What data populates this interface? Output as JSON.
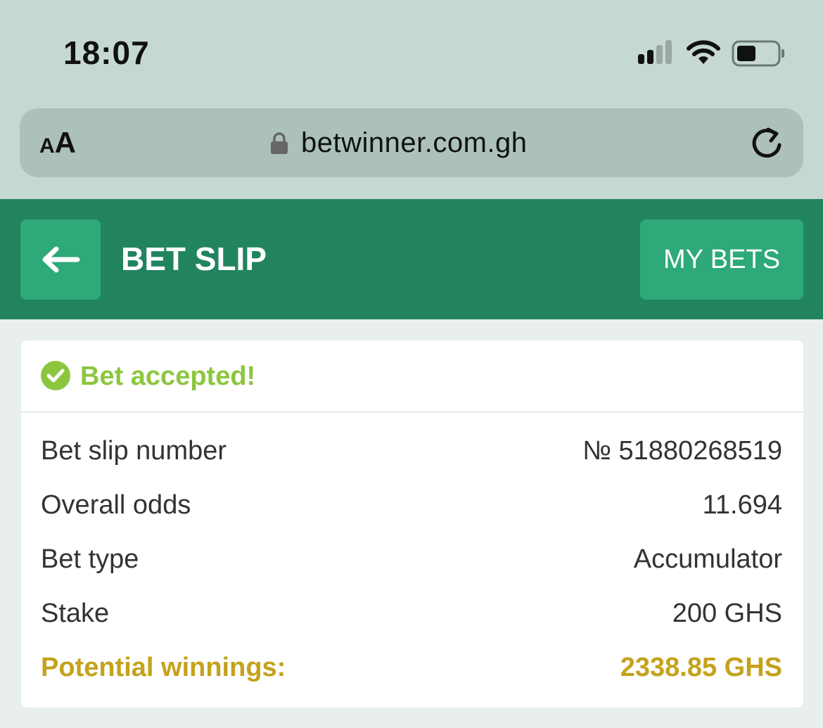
{
  "status_bar": {
    "time": "18:07"
  },
  "browser": {
    "text_size_label_small": "A",
    "text_size_label_large": "A",
    "url": "betwinner.com.gh"
  },
  "header": {
    "title": "BET SLIP",
    "my_bets_label": "MY BETS"
  },
  "bet": {
    "status": "Bet accepted!",
    "rows": [
      {
        "label": "Bet slip number",
        "value": "№ 51880268519"
      },
      {
        "label": "Overall odds",
        "value": "11.694"
      },
      {
        "label": "Bet type",
        "value": "Accumulator"
      },
      {
        "label": "Stake",
        "value": "200 GHS"
      },
      {
        "label": "Potential winnings:",
        "value": "2338.85 GHS"
      }
    ]
  },
  "colors": {
    "header_green": "#22845f",
    "button_green": "#2ea978",
    "accepted_green": "#8cc63f",
    "winnings_gold": "#c4a21b"
  }
}
